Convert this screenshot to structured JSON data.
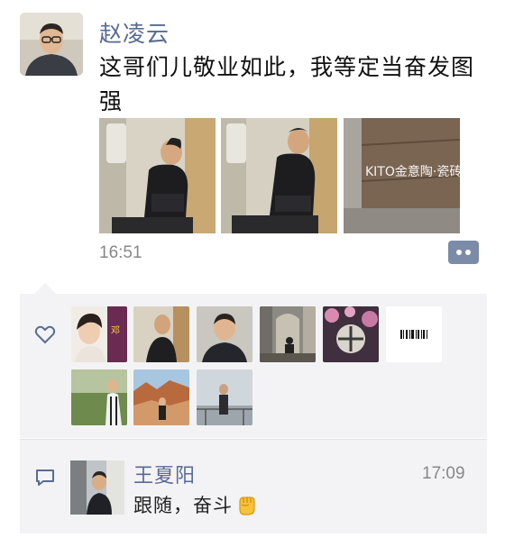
{
  "post": {
    "author": "赵凌云",
    "text": "这哥们儿敬业如此，我等定当奋发图强",
    "time": "16:51",
    "photos": [
      {
        "icon": "photo-man-seated-train"
      },
      {
        "icon": "photo-man-seated-train-2"
      },
      {
        "icon": "photo-showroom-wall"
      }
    ],
    "photo3_sign": "KITO金意陶·瓷砖"
  },
  "likes": {
    "icon": "heart-icon",
    "avatars": [
      {
        "icon": "liker-avatar-1",
        "caption": "邓"
      },
      {
        "icon": "liker-avatar-2"
      },
      {
        "icon": "liker-avatar-3"
      },
      {
        "icon": "liker-avatar-4"
      },
      {
        "icon": "liker-avatar-5"
      },
      {
        "icon": "liker-avatar-6"
      },
      {
        "icon": "liker-avatar-7"
      },
      {
        "icon": "liker-avatar-8"
      },
      {
        "icon": "liker-avatar-9"
      }
    ]
  },
  "comment": {
    "icon": "comment-icon",
    "name": "王夏阳",
    "time": "17:09",
    "text": "跟随，奋斗",
    "emoji": "fist-emoji"
  },
  "colors": {
    "name_link": "#576b95",
    "panel_bg": "#f3f3f5",
    "comment_button": "#7b8ba8"
  }
}
